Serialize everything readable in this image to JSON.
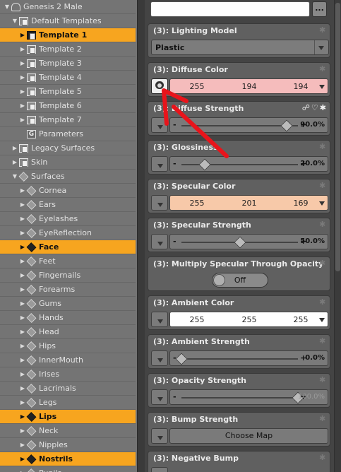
{
  "tree": {
    "items": [
      {
        "label": "Genesis 2 Male",
        "icon": "figure-icon",
        "selected": false
      },
      {
        "label": "Default Templates",
        "icon": "folder-icon",
        "selected": false
      },
      {
        "label": "Template 1",
        "icon": "folder-icon",
        "selected": true
      },
      {
        "label": "Template 2",
        "icon": "folder-icon",
        "selected": false
      },
      {
        "label": "Template 3",
        "icon": "folder-icon",
        "selected": false
      },
      {
        "label": "Template 4",
        "icon": "folder-icon",
        "selected": false
      },
      {
        "label": "Template 5",
        "icon": "folder-icon",
        "selected": false
      },
      {
        "label": "Template 6",
        "icon": "folder-icon",
        "selected": false
      },
      {
        "label": "Template 7",
        "icon": "folder-icon",
        "selected": false
      },
      {
        "label": "Parameters",
        "icon": "group-icon",
        "selected": false
      },
      {
        "label": "Legacy Surfaces",
        "icon": "folder-icon",
        "selected": false
      },
      {
        "label": "Skin",
        "icon": "folder-icon",
        "selected": false
      },
      {
        "label": "Surfaces",
        "icon": "surfaces-icon",
        "selected": false
      },
      {
        "label": "Cornea",
        "icon": "material-icon",
        "selected": false
      },
      {
        "label": "Ears",
        "icon": "material-icon",
        "selected": false
      },
      {
        "label": "Eyelashes",
        "icon": "material-icon",
        "selected": false
      },
      {
        "label": "EyeReflection",
        "icon": "material-icon",
        "selected": false
      },
      {
        "label": "Face",
        "icon": "material-icon",
        "selected": true
      },
      {
        "label": "Feet",
        "icon": "material-icon",
        "selected": false
      },
      {
        "label": "Fingernails",
        "icon": "material-icon",
        "selected": false
      },
      {
        "label": "Forearms",
        "icon": "material-icon",
        "selected": false
      },
      {
        "label": "Gums",
        "icon": "material-icon",
        "selected": false
      },
      {
        "label": "Hands",
        "icon": "material-icon",
        "selected": false
      },
      {
        "label": "Head",
        "icon": "material-icon",
        "selected": false
      },
      {
        "label": "Hips",
        "icon": "material-icon",
        "selected": false
      },
      {
        "label": "InnerMouth",
        "icon": "material-icon",
        "selected": false
      },
      {
        "label": "Irises",
        "icon": "material-icon",
        "selected": false
      },
      {
        "label": "Lacrimals",
        "icon": "material-icon",
        "selected": false
      },
      {
        "label": "Legs",
        "icon": "material-icon",
        "selected": false
      },
      {
        "label": "Lips",
        "icon": "material-icon",
        "selected": true
      },
      {
        "label": "Neck",
        "icon": "material-icon",
        "selected": false
      },
      {
        "label": "Nipples",
        "icon": "material-icon",
        "selected": false
      },
      {
        "label": "Nostrils",
        "icon": "material-icon",
        "selected": true
      },
      {
        "label": "Pupils",
        "icon": "material-icon",
        "selected": false
      }
    ]
  },
  "panel": {
    "top_button": "...",
    "lighting": {
      "title": "(3): Lighting Model",
      "value": "Plastic"
    },
    "diffuse_color": {
      "title": "(3): Diffuse Color",
      "r": "255",
      "g": "194",
      "b": "194",
      "bg": "#f5bcbc"
    },
    "diffuse_strength": {
      "title": "(3): Diffuse Strength",
      "min": "-",
      "max": "+",
      "value": "90.0%",
      "level": 0.9
    },
    "glossiness": {
      "title": "(3): Glossiness",
      "min": "-",
      "max": "+",
      "value": "20.0%",
      "level": 0.2
    },
    "specular_color": {
      "title": "(3): Specular Color",
      "r": "255",
      "g": "201",
      "b": "169",
      "bg": "#f7c9a9"
    },
    "specular_strength": {
      "title": "(3): Specular Strength",
      "min": "-",
      "max": "+",
      "value": "50.0%",
      "level": 0.5
    },
    "multiply_specular": {
      "title": "(3): Multiply Specular Through Opacity",
      "value": "Off"
    },
    "ambient_color": {
      "title": "(3): Ambient Color",
      "r": "255",
      "g": "255",
      "b": "255",
      "bg": "#ffffff"
    },
    "ambient_strength": {
      "title": "(3): Ambient Strength",
      "min": "-",
      "max": "+",
      "value": "0.0%",
      "level": 0.0
    },
    "opacity_strength": {
      "title": "(3): Opacity Strength",
      "min": "-",
      "max": "+",
      "value": "100.0%",
      "level": 1.0
    },
    "bump_strength": {
      "title": "(3): Bump Strength",
      "map_label": "Choose Map"
    },
    "negative_bump": {
      "title": "(3): Negative Bump"
    }
  },
  "colors": {
    "selected": "#f7a51f",
    "annotation_arrow": "#e8141b"
  }
}
